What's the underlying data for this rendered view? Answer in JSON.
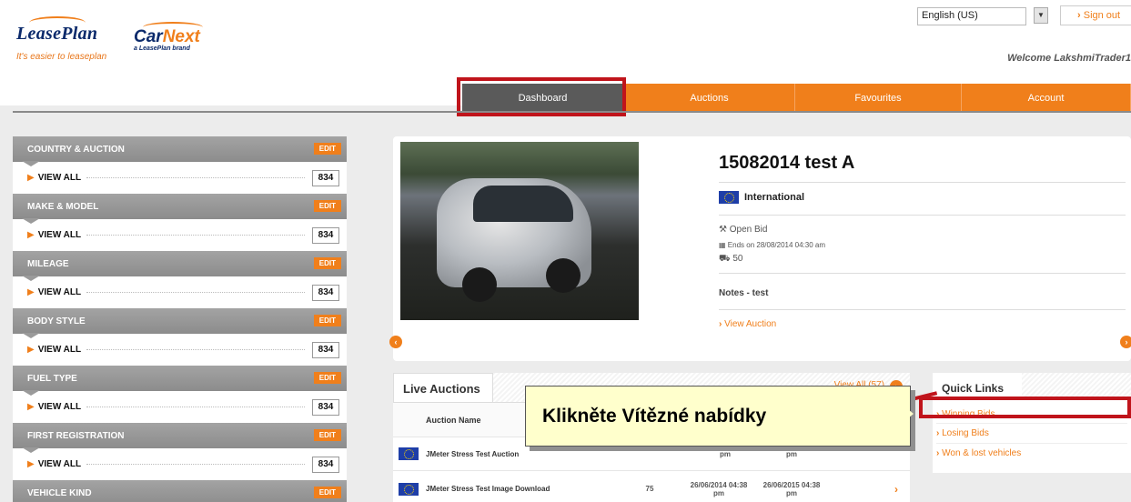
{
  "header": {
    "leaseplan_logo": "LeasePlan",
    "leaseplan_tagline": "It's easier to leaseplan",
    "carnext_logo_a": "Car",
    "carnext_logo_b": "Next",
    "carnext_tagline": "a LeasePlan brand",
    "language": "English (US)",
    "signout_label": "Sign out",
    "welcome": "Welcome LakshmiTrader1"
  },
  "nav": {
    "dashboard": "Dashboard",
    "auctions": "Auctions",
    "favourites": "Favourites",
    "account": "Account"
  },
  "filters": [
    {
      "title": "COUNTRY & AUCTION",
      "edit": "EDIT",
      "row": "VIEW ALL",
      "count": "834"
    },
    {
      "title": "MAKE & MODEL",
      "edit": "EDIT",
      "row": "VIEW ALL",
      "count": "834"
    },
    {
      "title": "MILEAGE",
      "edit": "EDIT",
      "row": "VIEW ALL",
      "count": "834"
    },
    {
      "title": "BODY STYLE",
      "edit": "EDIT",
      "row": "VIEW ALL",
      "count": "834"
    },
    {
      "title": "FUEL TYPE",
      "edit": "EDIT",
      "row": "VIEW ALL",
      "count": "834"
    },
    {
      "title": "FIRST REGISTRATION",
      "edit": "EDIT",
      "row": "VIEW ALL",
      "count": "834"
    },
    {
      "title": "VEHICLE KIND",
      "edit": "EDIT"
    }
  ],
  "featured": {
    "title": "15082014 test A",
    "region": "International",
    "bid_type": "Open Bid",
    "ends": "Ends on 28/08/2014 04:30 am",
    "vehicles": "50",
    "notes": "Notes - test",
    "view_auction": "View Auction"
  },
  "live_auctions": {
    "title": "Live Auctions",
    "view_all": "View All (57)",
    "column_auction_name": "Auction Name",
    "rows": [
      {
        "name": "JMeter Stress Test Auction",
        "start_time": "pm",
        "end_time": "pm"
      },
      {
        "name": "JMeter Stress Test Image Download",
        "count": "75",
        "start_date": "26/06/2014 04:38",
        "start_time": "pm",
        "end_date": "26/06/2015 04:38",
        "end_time": "pm"
      }
    ]
  },
  "quick_links": {
    "title": "Quick Links",
    "items": [
      "Winning Bids",
      "Losing Bids",
      "Won & lost vehicles"
    ]
  },
  "callout": {
    "text": "Klikněte Vítězné nabídky"
  },
  "colors": {
    "accent": "#f07f1b",
    "brand_blue": "#0b2a6b",
    "highlight_red": "#c0141b",
    "callout_bg": "#ffffcc"
  }
}
